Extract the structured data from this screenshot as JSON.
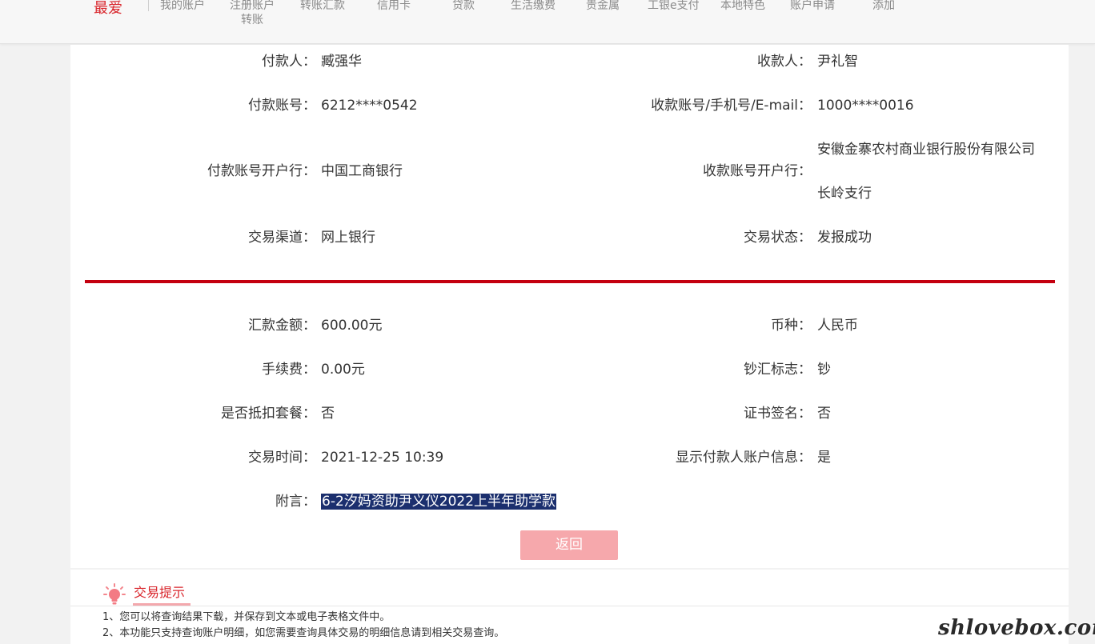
{
  "nav": {
    "favorite": "最爱",
    "items": [
      {
        "label": "我的账户"
      },
      {
        "label": "注册账户转账",
        "line1": "注册账户",
        "line2": "转账"
      },
      {
        "label": "转账汇款"
      },
      {
        "label": "信用卡"
      },
      {
        "label": "贷款"
      },
      {
        "label": "生活缴费"
      },
      {
        "label": "贵金属"
      },
      {
        "label": "工银e支付"
      },
      {
        "label": "本地特色"
      },
      {
        "label": "账户申请"
      },
      {
        "label": "添加"
      }
    ]
  },
  "detail": {
    "payer_label": "付款人：",
    "payer": "臧强华",
    "payee_label": "收款人：",
    "payee": "尹礼智",
    "payer_account_label": "付款账号：",
    "payer_account": "6212****0542",
    "payee_account_label": "收款账号/手机号/E-mail：",
    "payee_account": "1000****0016",
    "payer_bank_label": "付款账号开户行：",
    "payer_bank": "中国工商银行",
    "payee_bank_label": "收款账号开户行：",
    "payee_bank_line1": "安徽金寨农村商业银行股份有限公司",
    "payee_bank_line2": "长岭支行",
    "channel_label": "交易渠道：",
    "channel": "网上银行",
    "status_label": "交易状态：",
    "status": "发报成功",
    "amount_label": "汇款金额：",
    "amount": "600.00元",
    "currency_label": "币种：",
    "currency": "人民币",
    "fee_label": "手续费：",
    "fee": "0.00元",
    "cash_flag_label": "钞汇标志：",
    "cash_flag": "钞",
    "package_label": "是否抵扣套餐：",
    "package": "否",
    "cert_label": "证书签名：",
    "cert": "否",
    "time_label": "交易时间：",
    "time": "2021-12-25 10:39",
    "show_payer_label": "显示付款人账户信息：",
    "show_payer": "是",
    "memo_label": "附言：",
    "memo": "6-2汐妈资助尹义仪2022上半年助学款"
  },
  "return_button": "返回",
  "tips": {
    "title": "交易提示",
    "lines": [
      "1、您可以将查询结果下载，并保存到文本或电子表格文件中。",
      "2、本功能只支持查询账户明细，如您需要查询具体交易的明细信息请到相关交易查询。"
    ]
  },
  "watermark": "shlovebox.com",
  "colors": {
    "accent_red": "#c4000f",
    "button_pink": "#f6a8ac",
    "highlight_navy": "#1b2f6e"
  }
}
